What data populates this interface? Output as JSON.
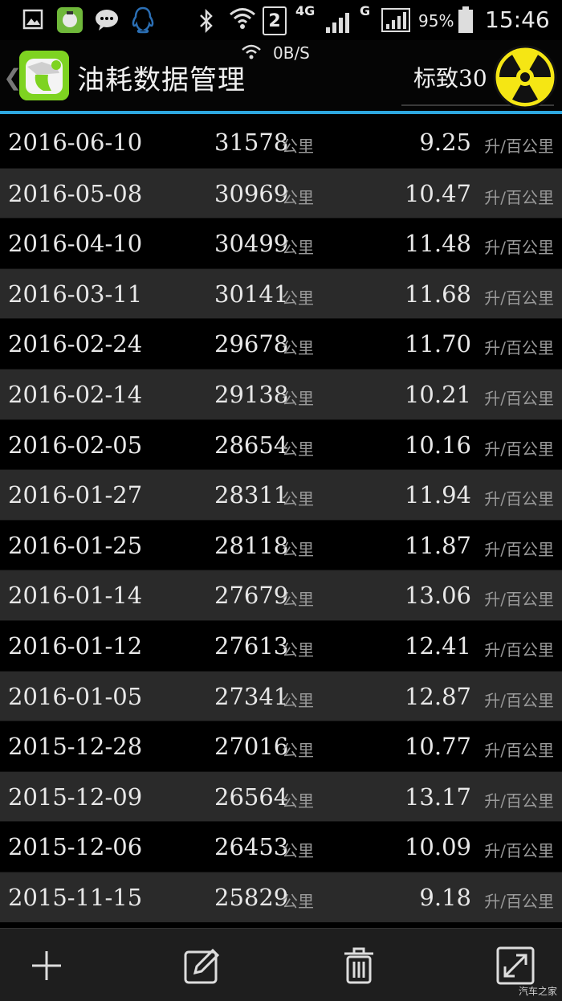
{
  "status_bar": {
    "sim_slot": "2",
    "network_4g": "4G",
    "network_g": "G",
    "battery": "95%",
    "time": "15:46",
    "icons": [
      "gallery-icon",
      "app-icon",
      "chat-icon",
      "qq-icon",
      "bluetooth-icon",
      "wifi-icon",
      "signal-icon",
      "battery-icon"
    ]
  },
  "header": {
    "title": "油耗数据管理",
    "net_speed": "0B/S",
    "car_name": "标致30"
  },
  "units": {
    "distance": "公里",
    "consumption": "升/百公里"
  },
  "records": [
    {
      "date": "2016-06-10",
      "odometer": "31578",
      "consumption": "9.25"
    },
    {
      "date": "2016-05-08",
      "odometer": "30969",
      "consumption": "10.47"
    },
    {
      "date": "2016-04-10",
      "odometer": "30499",
      "consumption": "11.48"
    },
    {
      "date": "2016-03-11",
      "odometer": "30141",
      "consumption": "11.68"
    },
    {
      "date": "2016-02-24",
      "odometer": "29678",
      "consumption": "11.70"
    },
    {
      "date": "2016-02-14",
      "odometer": "29138",
      "consumption": "10.21"
    },
    {
      "date": "2016-02-05",
      "odometer": "28654",
      "consumption": "10.16"
    },
    {
      "date": "2016-01-27",
      "odometer": "28311",
      "consumption": "11.94"
    },
    {
      "date": "2016-01-25",
      "odometer": "28118",
      "consumption": "11.87"
    },
    {
      "date": "2016-01-14",
      "odometer": "27679",
      "consumption": "13.06"
    },
    {
      "date": "2016-01-12",
      "odometer": "27613",
      "consumption": "12.41"
    },
    {
      "date": "2016-01-05",
      "odometer": "27341",
      "consumption": "12.87"
    },
    {
      "date": "2015-12-28",
      "odometer": "27016",
      "consumption": "10.77"
    },
    {
      "date": "2015-12-09",
      "odometer": "26564",
      "consumption": "13.17"
    },
    {
      "date": "2015-12-06",
      "odometer": "26453",
      "consumption": "10.09"
    },
    {
      "date": "2015-11-15",
      "odometer": "25829",
      "consumption": "9.18"
    }
  ],
  "toolbar": {
    "buttons": [
      "add-icon",
      "edit-icon",
      "delete-icon",
      "expand-icon"
    ]
  },
  "watermark": "汽车之家",
  "colors": {
    "accent": "#2ea8e0",
    "row_alt": "#2a2a2a",
    "logo_green": "#7ed321",
    "radiation_yellow": "#f5e614"
  }
}
